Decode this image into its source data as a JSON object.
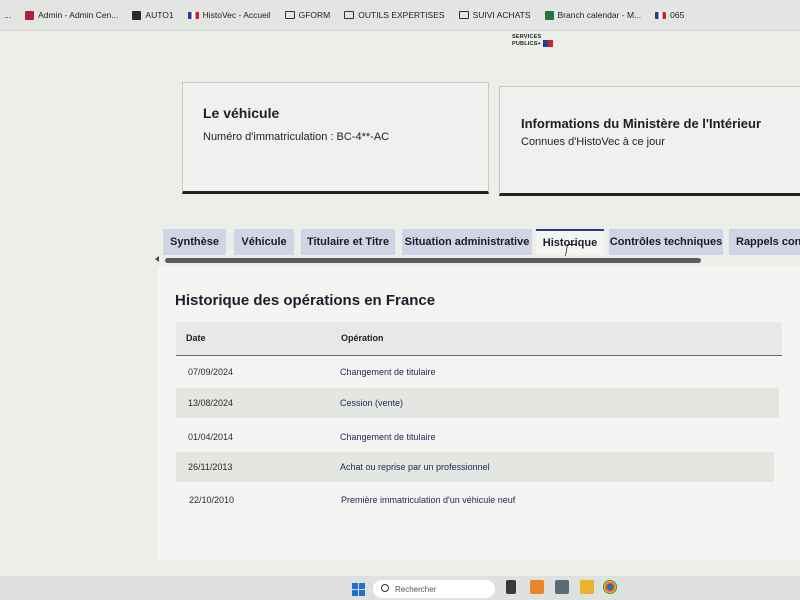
{
  "bookmarks": [
    {
      "label": "...",
      "icon": "page-icon"
    },
    {
      "label": "Admin - Admin Cen...",
      "icon": "admin-icon"
    },
    {
      "label": "AUTO1",
      "icon": "auto1-icon"
    },
    {
      "label": "HistoVec - Accueil",
      "icon": "flag-icon"
    },
    {
      "label": "GFORM",
      "icon": "folder-icon"
    },
    {
      "label": "OUTILS EXPERTISES",
      "icon": "folder-icon"
    },
    {
      "label": "SUIVI ACHATS",
      "icon": "folder-icon"
    },
    {
      "label": "Branch calendar - M...",
      "icon": "calendar-icon"
    },
    {
      "label": "065",
      "icon": "flag-icon"
    }
  ],
  "logo": {
    "line1": "SERVICES",
    "line2": "PUBLICS+"
  },
  "vehicle_card": {
    "title": "Le véhicule",
    "subtitle": "Numéro d'immatriculation : BC-4**-AC"
  },
  "ministry_card": {
    "title": "Informations du Ministère de l'Intérieur",
    "subtitle": "Connues d'HistoVec à ce jour"
  },
  "tabs": [
    {
      "label": "Synthèse",
      "active": false
    },
    {
      "label": "Véhicule",
      "active": false
    },
    {
      "label": "Titulaire et Titre",
      "active": false
    },
    {
      "label": "Situation administrative",
      "active": false
    },
    {
      "label": "Historique",
      "active": true
    },
    {
      "label": "Contrôles techniques",
      "active": false
    },
    {
      "label": "Rappels constr",
      "active": false
    }
  ],
  "history": {
    "title": "Historique des opérations en France",
    "columns": [
      "Date",
      "Opération"
    ],
    "rows": [
      {
        "date": "07/09/2024",
        "operation": "Changement de titulaire"
      },
      {
        "date": "13/08/2024",
        "operation": "Cession (vente)"
      },
      {
        "date": "01/04/2014",
        "operation": "Changement de titulaire"
      },
      {
        "date": "26/11/2013",
        "operation": "Achat ou reprise par un professionnel"
      },
      {
        "date": "22/10/2010",
        "operation": "Première immatriculation d'un véhicule neuf"
      }
    ]
  },
  "taskbar": {
    "search_placeholder": "Rechercher"
  },
  "colors": {
    "tab_bg": "#cfd5e4",
    "active_tab_border": "#2a3a8a",
    "operation_text": "#23265a"
  }
}
